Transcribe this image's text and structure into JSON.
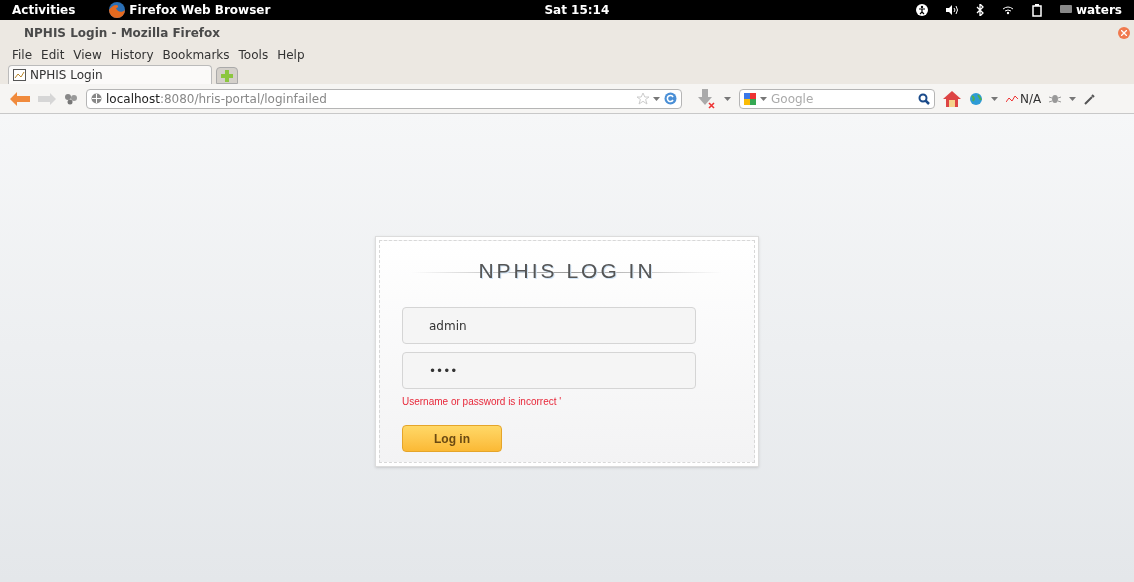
{
  "top_bar": {
    "activities": "Activities",
    "app": "Firefox Web Browser",
    "clock": "Sat 15:14",
    "user": "waters"
  },
  "window": {
    "title": "NPHIS Login - Mozilla Firefox"
  },
  "menu": [
    "File",
    "Edit",
    "View",
    "History",
    "Bookmarks",
    "Tools",
    "Help"
  ],
  "tabs": [
    {
      "label": "NPHIS Login",
      "selected": true
    }
  ],
  "address": {
    "host": "localhost",
    "path": ":8080/hris-portal/loginfailed"
  },
  "search": {
    "placeholder": "Google"
  },
  "addon_label": "N/A",
  "login": {
    "title": "NPHIS LOG IN",
    "username": "admin",
    "password": "••••",
    "error": "Username or password is incorrect '",
    "button": "Log in"
  }
}
